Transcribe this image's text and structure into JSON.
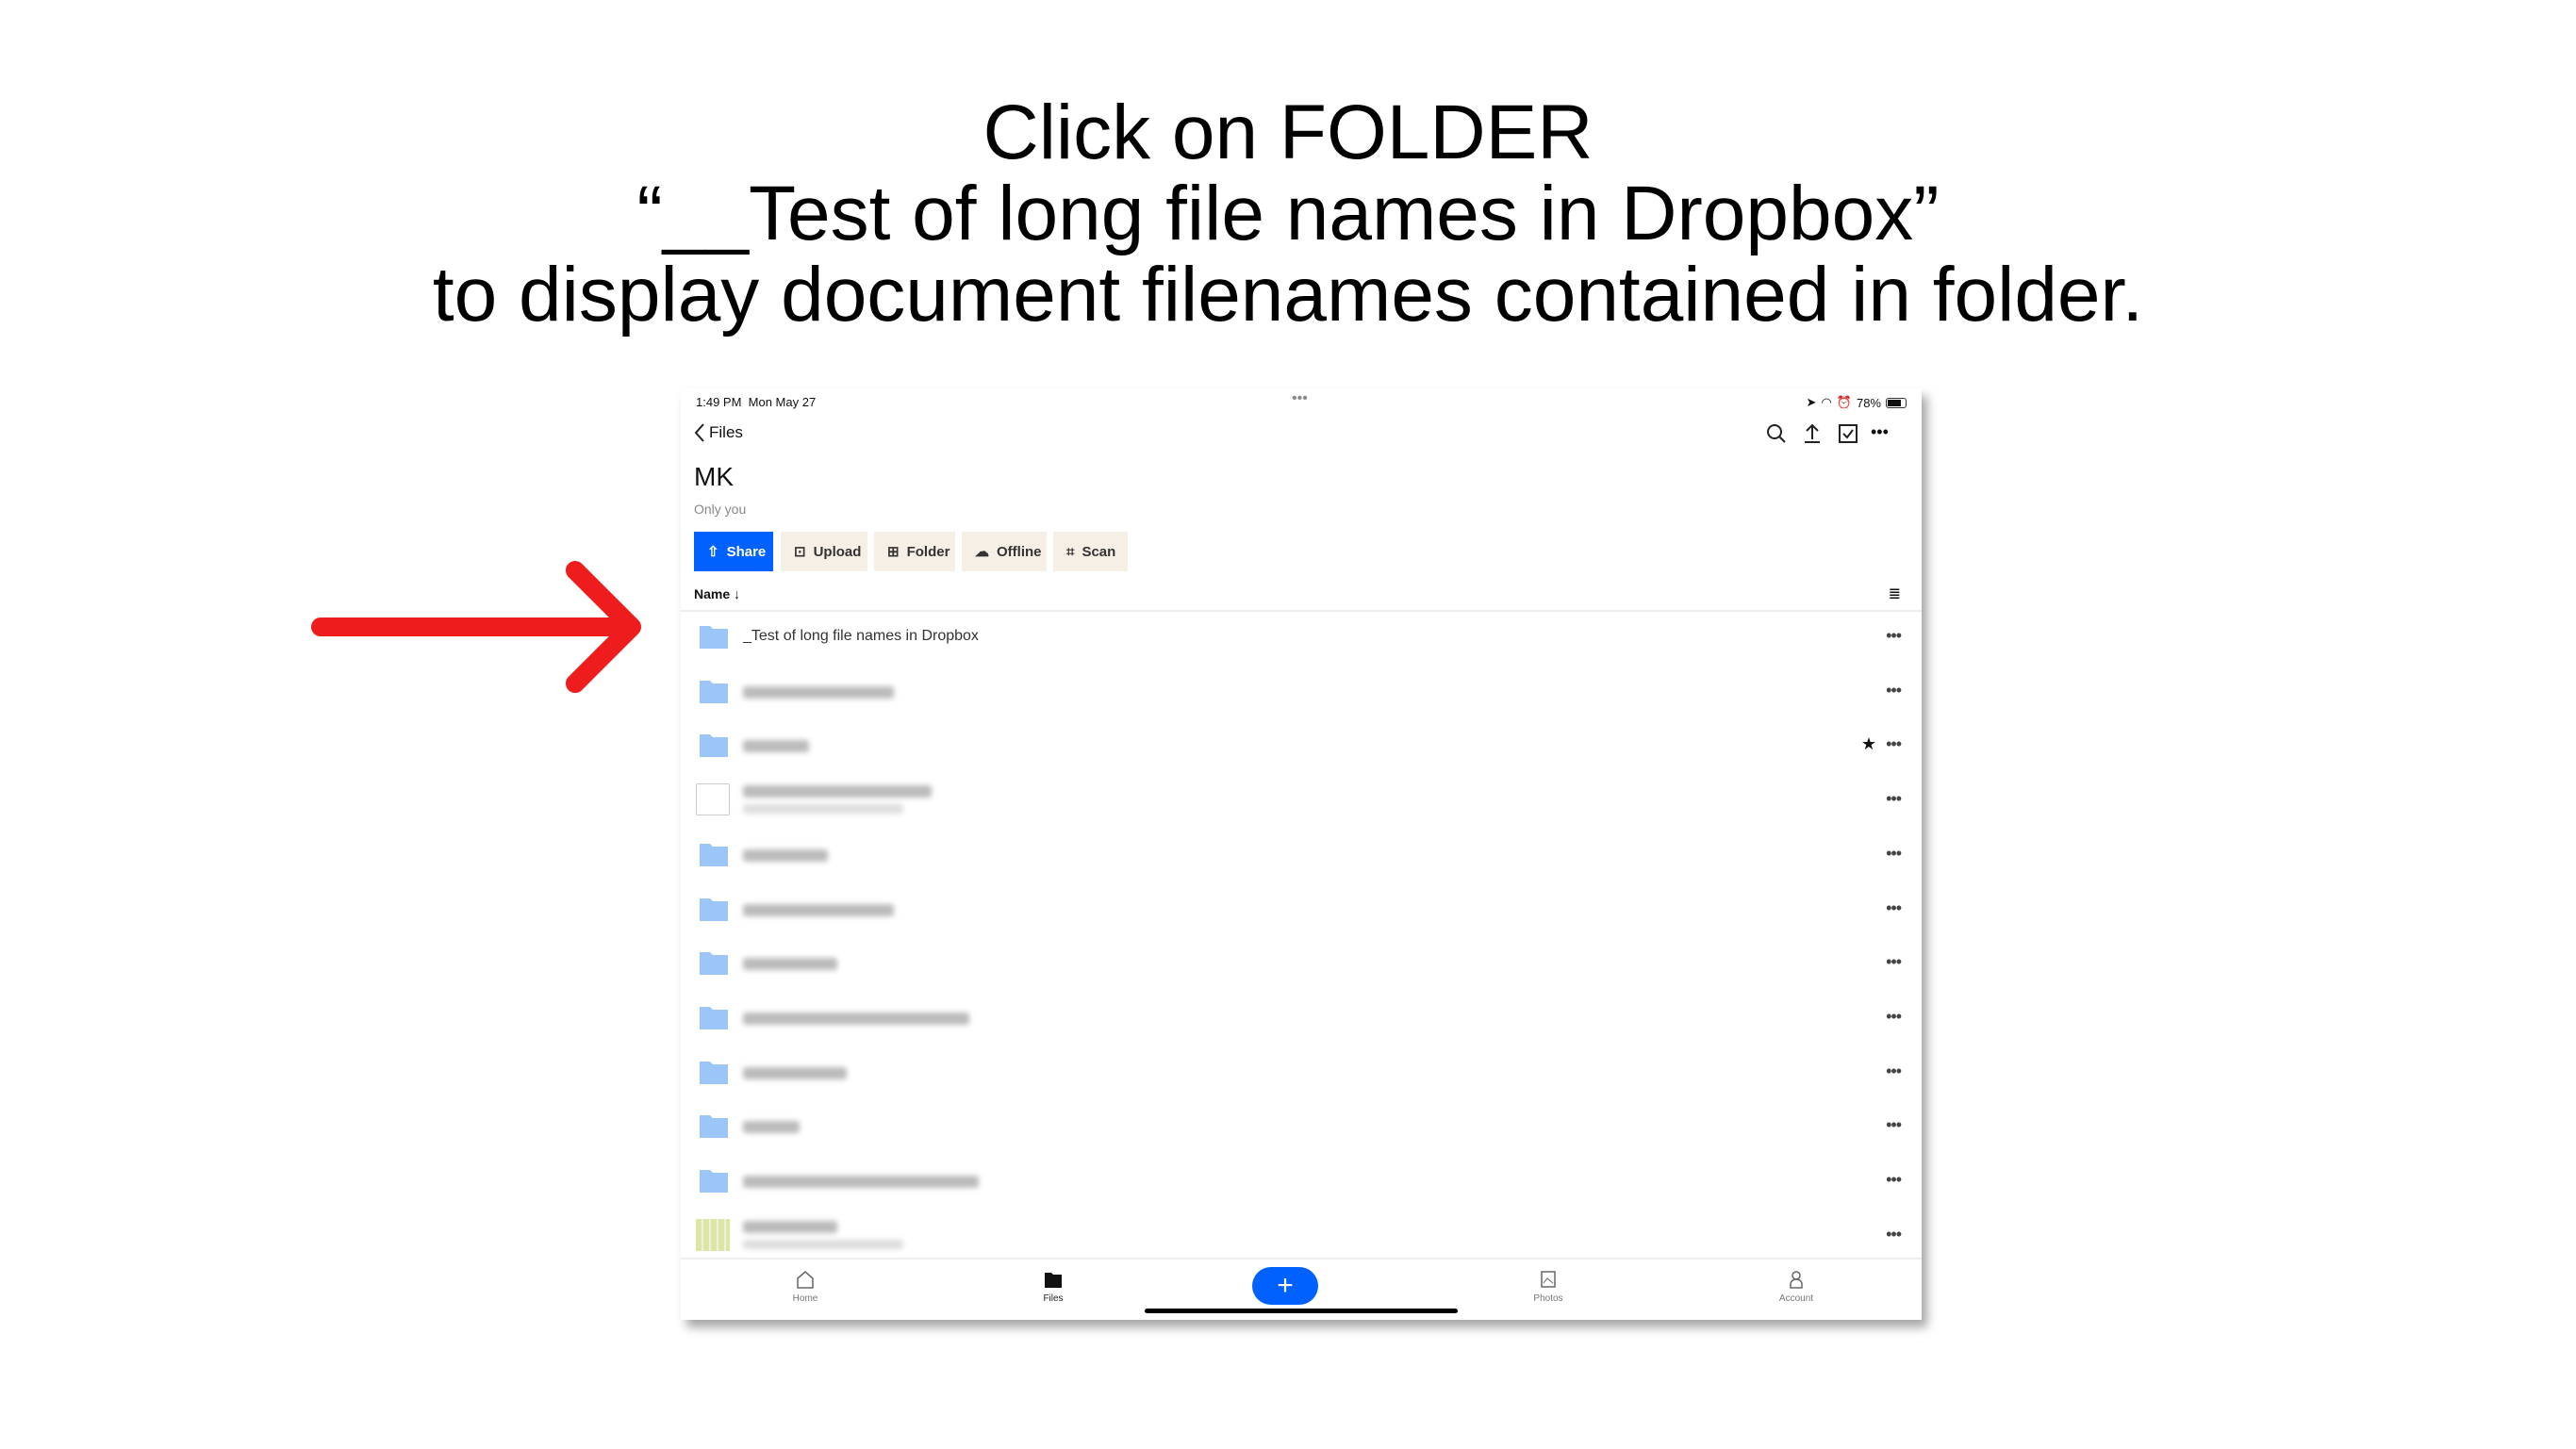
{
  "instruction": {
    "lines": [
      "Click on FOLDER",
      "“__Test of long file names in Dropbox”",
      "to display document filenames contained in folder."
    ],
    "arrow_color": "#ee1c1c"
  },
  "status_bar": {
    "time": "1:49 PM",
    "date": "Mon May 27",
    "battery": "78%"
  },
  "header": {
    "back_label": "Files",
    "icons": [
      "search-icon",
      "upload-icon",
      "select-icon",
      "more-icon"
    ]
  },
  "folder": {
    "title": "MK",
    "subtitle": "Only you"
  },
  "toolbar": {
    "share": "Share",
    "upload": "Upload",
    "folder": "Folder",
    "offline": "Offline",
    "scan": "Scan",
    "accent": "#0061fe"
  },
  "list": {
    "sort_label": "Name",
    "first_item": "_Test of long file names in Dropbox",
    "items": [
      {
        "type": "folder"
      },
      {
        "type": "folder"
      },
      {
        "type": "folder",
        "starred": true
      },
      {
        "type": "file"
      },
      {
        "type": "folder"
      },
      {
        "type": "folder"
      },
      {
        "type": "folder"
      },
      {
        "type": "folder"
      },
      {
        "type": "folder"
      },
      {
        "type": "folder"
      },
      {
        "type": "folder"
      },
      {
        "type": "spreadsheet"
      }
    ]
  },
  "tab_bar": {
    "home": "Home",
    "files": "Files",
    "photos": "Photos",
    "account": "Account"
  }
}
